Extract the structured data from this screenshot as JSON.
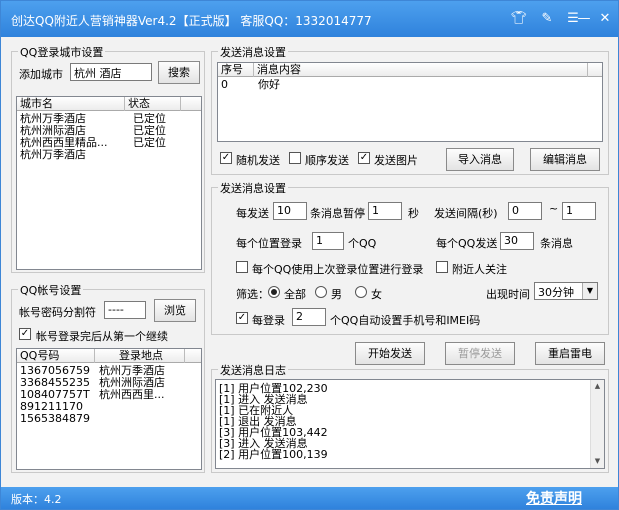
{
  "window": {
    "title": "创达QQ附近人营销神器Ver4.2【正式版】 客服QQ：1332014777",
    "version_text": "版本：4.2",
    "disclaimer": "免责声明"
  },
  "city_group": {
    "title": "QQ登录城市设置",
    "add_city_label": "添加城市",
    "search_value": "杭州 酒店",
    "search_button": "搜索",
    "columns": [
      "城市名",
      "状态"
    ],
    "rows": [
      {
        "name": "杭州万季酒店",
        "status": "已定位"
      },
      {
        "name": "杭州洲际酒店",
        "status": "已定位"
      },
      {
        "name": "杭州西西里精品...",
        "status": "已定位"
      },
      {
        "name": "杭州万季酒店",
        "status": ""
      }
    ]
  },
  "account_group": {
    "title": "QQ帐号设置",
    "separator_label": "帐号密码分割符",
    "separator_value": "----",
    "browse_button": "浏览",
    "continue_label": "帐号登录完后从第一个继续",
    "columns": [
      "QQ号码",
      "登录地点"
    ],
    "rows": [
      {
        "qq": "1367056759",
        "place": "杭州万季酒店"
      },
      {
        "qq": "3368455235",
        "place": "杭州洲际酒店"
      },
      {
        "qq": "108407757T",
        "place": "杭州西西里..."
      },
      {
        "qq": "891211170",
        "place": ""
      },
      {
        "qq": "1565384879",
        "place": ""
      }
    ]
  },
  "send_msg_group": {
    "title": "发送消息设置",
    "columns": [
      "序号",
      "消息内容"
    ],
    "rows": [
      {
        "idx": "0",
        "content": "你好"
      }
    ],
    "random_send": "随机发送",
    "order_send": "顺序发送",
    "send_image": "发送图片",
    "import_button": "导入消息",
    "edit_button": "编辑消息"
  },
  "send_settings": {
    "title": "发送消息设置",
    "every_send": "每发送",
    "every_send_value": "10",
    "pause_label": "条消息暂停",
    "pause_value": "1",
    "seconds": "秒",
    "interval_label": "发送间隔(秒)",
    "interval_min": "0",
    "tilde": "~",
    "interval_max": "1",
    "per_location_label": "每个位置登录",
    "per_location_value": "1",
    "qq_unit": "个QQ",
    "per_qq_label": "每个QQ发送",
    "per_qq_value": "30",
    "msg_unit": "条消息",
    "use_last_location": "每个QQ使用上次登录位置进行登录",
    "nearby_follow": "附近人关注",
    "filter_label": "筛选：",
    "filter_all": "全部",
    "filter_male": "男",
    "filter_female": "女",
    "appear_time_label": "出现时间",
    "appear_time_value": "30分钟",
    "per_login": "每登录",
    "per_login_value": "2",
    "auto_set_label": "个QQ自动设置手机号和IMEI码"
  },
  "actions": {
    "start": "开始发送",
    "pause": "暂停发送",
    "restart": "重启雷电"
  },
  "log_group": {
    "title": "发送消息日志",
    "lines": [
      "[1]  用户位置102,230",
      "[1]  进入 发送消息",
      "[1]  已在附近人",
      "[1]  退出 发消息",
      "[3]  用户位置103,442",
      "[3]  进入 发送消息",
      "[2]  用户位置100,139"
    ]
  }
}
